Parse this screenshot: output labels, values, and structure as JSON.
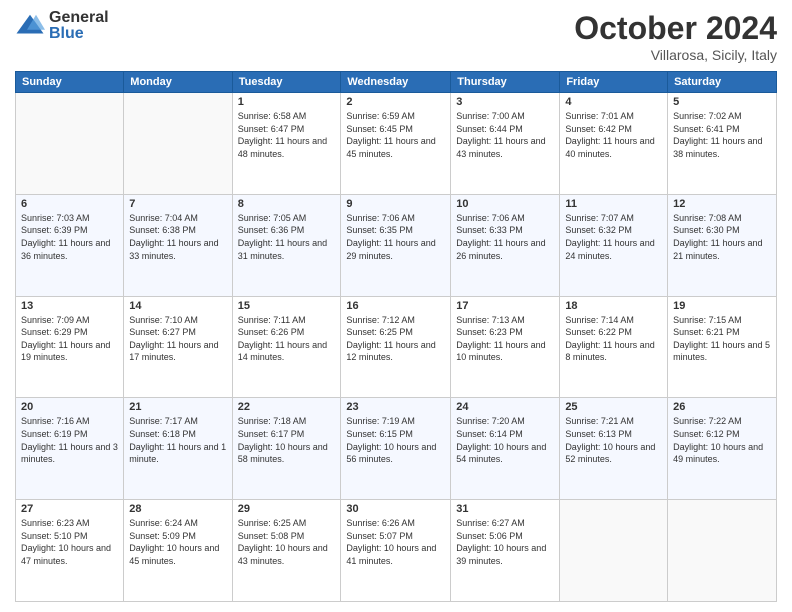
{
  "logo": {
    "general": "General",
    "blue": "Blue"
  },
  "header": {
    "month": "October 2024",
    "location": "Villarosa, Sicily, Italy"
  },
  "days_of_week": [
    "Sunday",
    "Monday",
    "Tuesday",
    "Wednesday",
    "Thursday",
    "Friday",
    "Saturday"
  ],
  "weeks": [
    [
      {
        "day": "",
        "info": ""
      },
      {
        "day": "",
        "info": ""
      },
      {
        "day": "1",
        "info": "Sunrise: 6:58 AM\nSunset: 6:47 PM\nDaylight: 11 hours and 48 minutes."
      },
      {
        "day": "2",
        "info": "Sunrise: 6:59 AM\nSunset: 6:45 PM\nDaylight: 11 hours and 45 minutes."
      },
      {
        "day": "3",
        "info": "Sunrise: 7:00 AM\nSunset: 6:44 PM\nDaylight: 11 hours and 43 minutes."
      },
      {
        "day": "4",
        "info": "Sunrise: 7:01 AM\nSunset: 6:42 PM\nDaylight: 11 hours and 40 minutes."
      },
      {
        "day": "5",
        "info": "Sunrise: 7:02 AM\nSunset: 6:41 PM\nDaylight: 11 hours and 38 minutes."
      }
    ],
    [
      {
        "day": "6",
        "info": "Sunrise: 7:03 AM\nSunset: 6:39 PM\nDaylight: 11 hours and 36 minutes."
      },
      {
        "day": "7",
        "info": "Sunrise: 7:04 AM\nSunset: 6:38 PM\nDaylight: 11 hours and 33 minutes."
      },
      {
        "day": "8",
        "info": "Sunrise: 7:05 AM\nSunset: 6:36 PM\nDaylight: 11 hours and 31 minutes."
      },
      {
        "day": "9",
        "info": "Sunrise: 7:06 AM\nSunset: 6:35 PM\nDaylight: 11 hours and 29 minutes."
      },
      {
        "day": "10",
        "info": "Sunrise: 7:06 AM\nSunset: 6:33 PM\nDaylight: 11 hours and 26 minutes."
      },
      {
        "day": "11",
        "info": "Sunrise: 7:07 AM\nSunset: 6:32 PM\nDaylight: 11 hours and 24 minutes."
      },
      {
        "day": "12",
        "info": "Sunrise: 7:08 AM\nSunset: 6:30 PM\nDaylight: 11 hours and 21 minutes."
      }
    ],
    [
      {
        "day": "13",
        "info": "Sunrise: 7:09 AM\nSunset: 6:29 PM\nDaylight: 11 hours and 19 minutes."
      },
      {
        "day": "14",
        "info": "Sunrise: 7:10 AM\nSunset: 6:27 PM\nDaylight: 11 hours and 17 minutes."
      },
      {
        "day": "15",
        "info": "Sunrise: 7:11 AM\nSunset: 6:26 PM\nDaylight: 11 hours and 14 minutes."
      },
      {
        "day": "16",
        "info": "Sunrise: 7:12 AM\nSunset: 6:25 PM\nDaylight: 11 hours and 12 minutes."
      },
      {
        "day": "17",
        "info": "Sunrise: 7:13 AM\nSunset: 6:23 PM\nDaylight: 11 hours and 10 minutes."
      },
      {
        "day": "18",
        "info": "Sunrise: 7:14 AM\nSunset: 6:22 PM\nDaylight: 11 hours and 8 minutes."
      },
      {
        "day": "19",
        "info": "Sunrise: 7:15 AM\nSunset: 6:21 PM\nDaylight: 11 hours and 5 minutes."
      }
    ],
    [
      {
        "day": "20",
        "info": "Sunrise: 7:16 AM\nSunset: 6:19 PM\nDaylight: 11 hours and 3 minutes."
      },
      {
        "day": "21",
        "info": "Sunrise: 7:17 AM\nSunset: 6:18 PM\nDaylight: 11 hours and 1 minute."
      },
      {
        "day": "22",
        "info": "Sunrise: 7:18 AM\nSunset: 6:17 PM\nDaylight: 10 hours and 58 minutes."
      },
      {
        "day": "23",
        "info": "Sunrise: 7:19 AM\nSunset: 6:15 PM\nDaylight: 10 hours and 56 minutes."
      },
      {
        "day": "24",
        "info": "Sunrise: 7:20 AM\nSunset: 6:14 PM\nDaylight: 10 hours and 54 minutes."
      },
      {
        "day": "25",
        "info": "Sunrise: 7:21 AM\nSunset: 6:13 PM\nDaylight: 10 hours and 52 minutes."
      },
      {
        "day": "26",
        "info": "Sunrise: 7:22 AM\nSunset: 6:12 PM\nDaylight: 10 hours and 49 minutes."
      }
    ],
    [
      {
        "day": "27",
        "info": "Sunrise: 6:23 AM\nSunset: 5:10 PM\nDaylight: 10 hours and 47 minutes."
      },
      {
        "day": "28",
        "info": "Sunrise: 6:24 AM\nSunset: 5:09 PM\nDaylight: 10 hours and 45 minutes."
      },
      {
        "day": "29",
        "info": "Sunrise: 6:25 AM\nSunset: 5:08 PM\nDaylight: 10 hours and 43 minutes."
      },
      {
        "day": "30",
        "info": "Sunrise: 6:26 AM\nSunset: 5:07 PM\nDaylight: 10 hours and 41 minutes."
      },
      {
        "day": "31",
        "info": "Sunrise: 6:27 AM\nSunset: 5:06 PM\nDaylight: 10 hours and 39 minutes."
      },
      {
        "day": "",
        "info": ""
      },
      {
        "day": "",
        "info": ""
      }
    ]
  ]
}
